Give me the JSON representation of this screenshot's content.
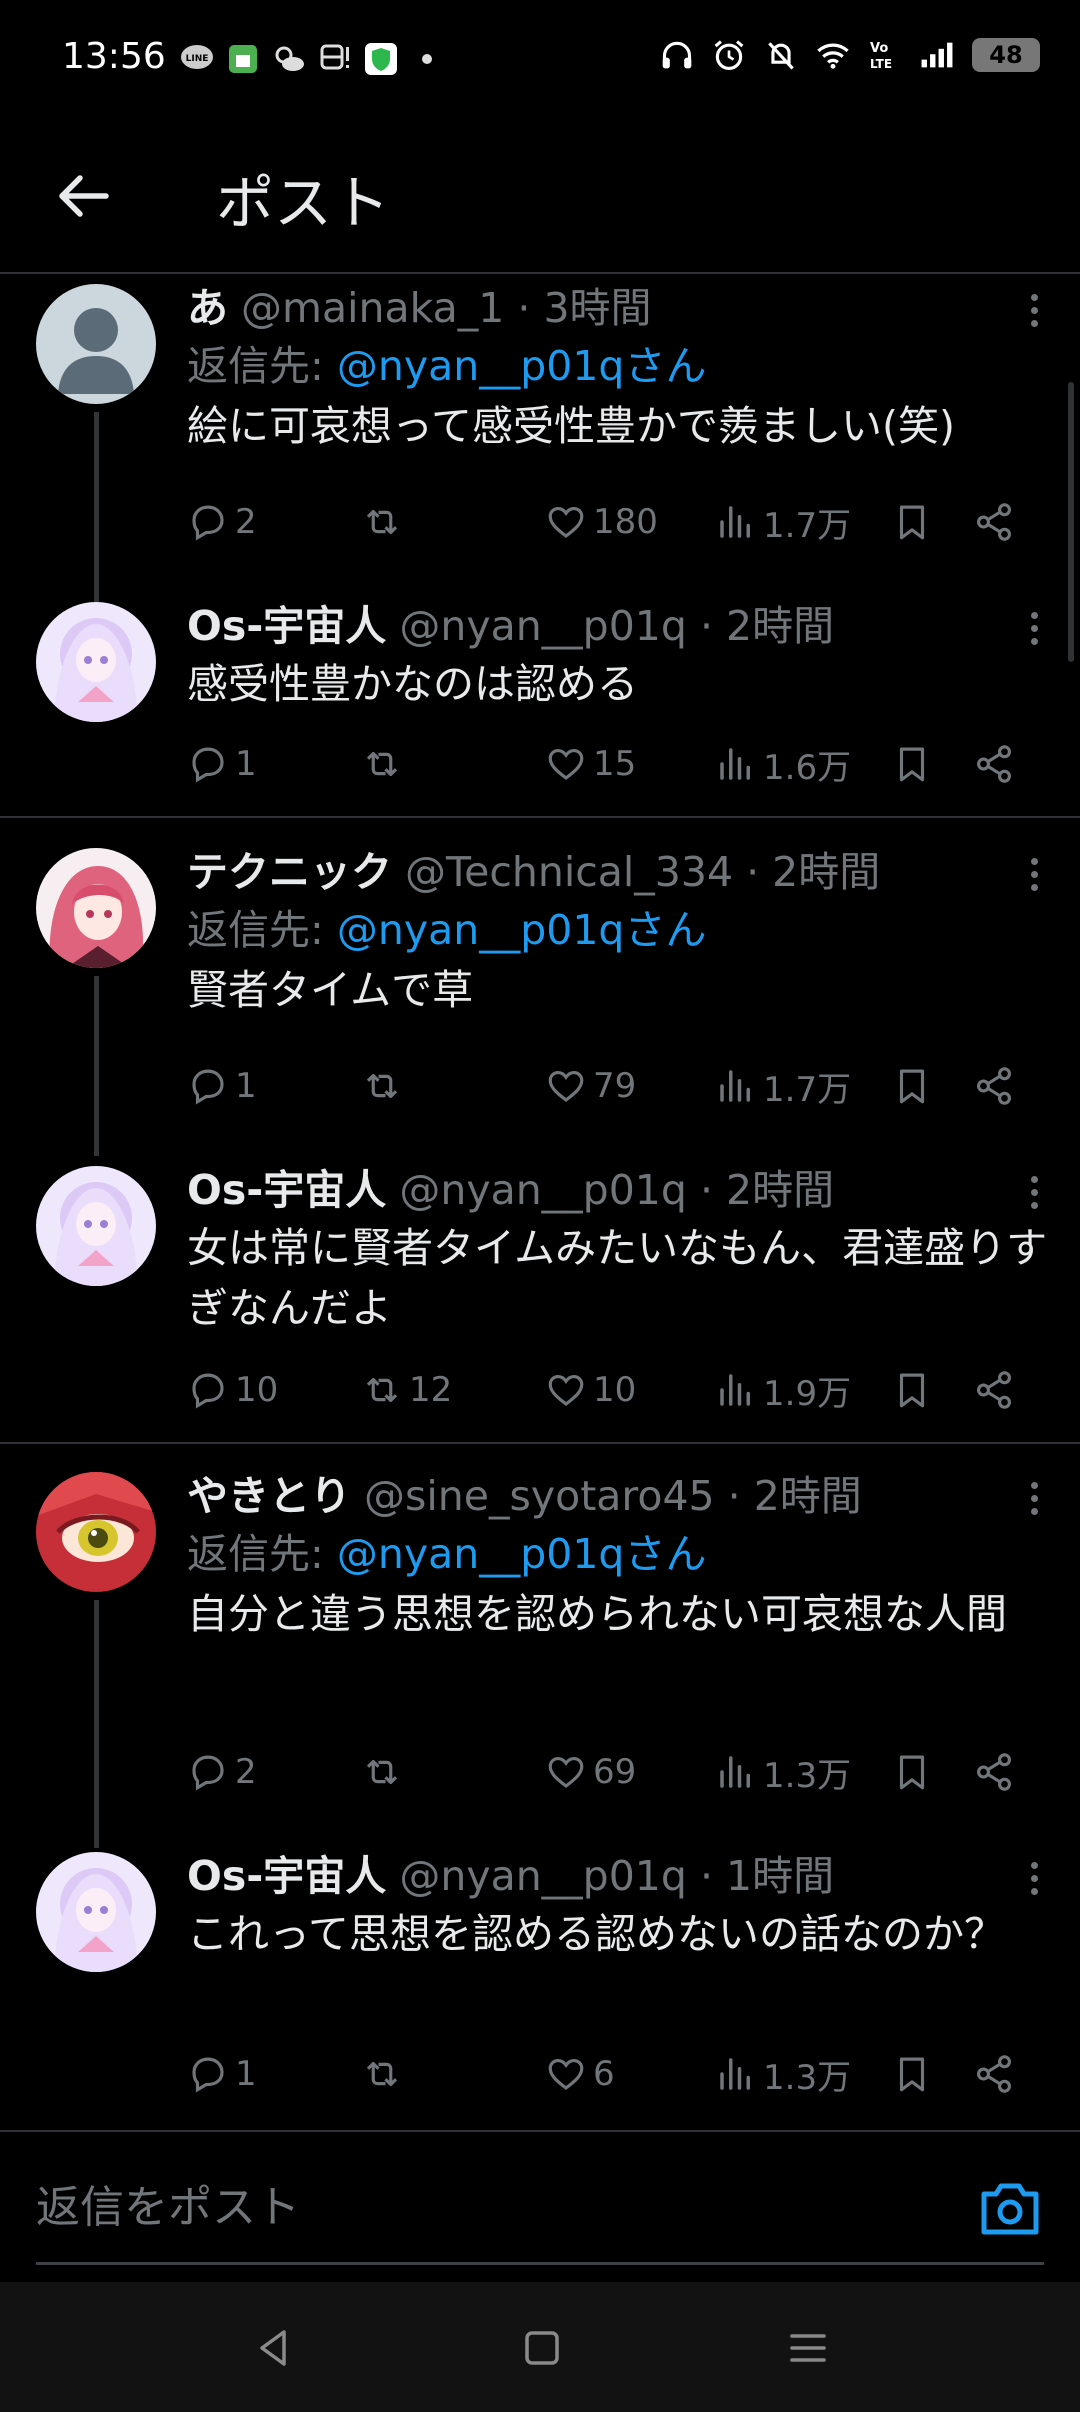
{
  "status_bar": {
    "time": "13:56",
    "battery": "48",
    "left_icons": [
      "line-icon",
      "shop-icon",
      "weather-icon",
      "train-icon",
      "shield-icon",
      "dot-icon"
    ],
    "right_icons": [
      "headphones-icon",
      "alarm-icon",
      "bell-muted-icon",
      "wifi-icon",
      "volte-icon",
      "signal-icon",
      "battery-icon"
    ]
  },
  "header": {
    "title": "ポスト"
  },
  "reply_prefix": "返信先:",
  "posts": [
    {
      "name": "あ",
      "meta": "@mainaka_1 · 3時間",
      "reply_to": "@nyan__p01qさん",
      "text": "絵に可哀想って感受性豊かで羨ましい(笑)",
      "replies": "2",
      "reposts": "",
      "likes": "180",
      "views": "1.7万"
    },
    {
      "name": "Os-宇宙人",
      "meta": "@nyan__p01q · 2時間",
      "text": "感受性豊かなのは認める",
      "replies": "1",
      "reposts": "",
      "likes": "15",
      "views": "1.6万"
    },
    {
      "name": "テクニック",
      "meta": "@Technical_334 · 2時間",
      "reply_to": "@nyan__p01qさん",
      "text": "賢者タイムで草",
      "replies": "1",
      "reposts": "",
      "likes": "79",
      "views": "1.7万"
    },
    {
      "name": "Os-宇宙人",
      "meta": "@nyan__p01q · 2時間",
      "text": "女は常に賢者タイムみたいなもん、君達盛りすぎなんだよ",
      "replies": "10",
      "reposts": "12",
      "likes": "10",
      "views": "1.9万"
    },
    {
      "name": "やきとり",
      "meta": "@sine_syotaro45 · 2時間",
      "reply_to": "@nyan__p01qさん",
      "text": "自分と違う思想を認められない可哀想な人間",
      "replies": "2",
      "reposts": "",
      "likes": "69",
      "views": "1.3万"
    },
    {
      "name": "Os-宇宙人",
      "meta": "@nyan__p01q · 1時間",
      "text": "これって思想を認める認めないの話なのか？",
      "replies": "1",
      "reposts": "",
      "likes": "6",
      "views": "1.3万"
    }
  ],
  "reply_bar": {
    "placeholder": "返信をポスト"
  },
  "colors": {
    "background": "#000000",
    "accent": "#1d9bf0",
    "muted": "#71767b",
    "text": "#e7e9ea"
  }
}
